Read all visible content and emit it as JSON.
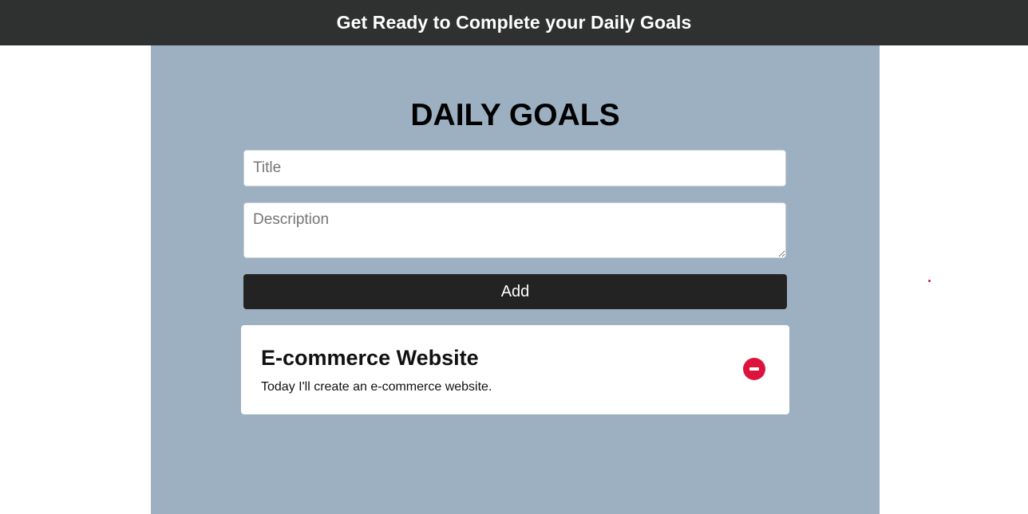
{
  "header": {
    "title": "Get Ready to Complete your Daily Goals"
  },
  "main": {
    "heading": "DAILY GOALS",
    "form": {
      "title_placeholder": "Title",
      "title_value": "",
      "description_placeholder": "Description",
      "description_value": "",
      "add_label": "Add"
    },
    "goals": [
      {
        "title": "E-commerce Website",
        "description": "Today I'll create an e-commerce website.",
        "remove_icon": "minus-circle-icon"
      }
    ]
  },
  "colors": {
    "header_bg": "#2f3030",
    "panel_bg": "#9cb0c2",
    "button_bg": "#232323",
    "remove_accent": "#dc143c"
  }
}
